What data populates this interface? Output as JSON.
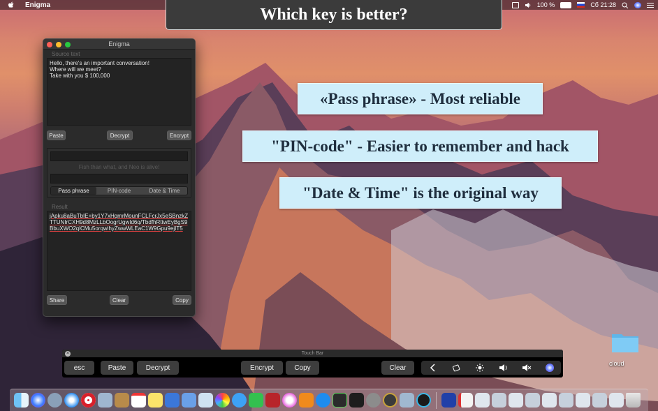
{
  "menubar": {
    "app_name": "Enigma",
    "battery": "100 %",
    "clock": "Сб 21:28"
  },
  "banner": {
    "text": "Which key is better?"
  },
  "callouts": [
    {
      "text": "«Pass phrase» - Most reliable"
    },
    {
      "text": "\"PIN-code\" - Easier to remember and hack"
    },
    {
      "text": "\"Date & Time\" is the original way"
    }
  ],
  "window": {
    "title": "Enigma",
    "source_label": "Source text",
    "source_text": "Hello, there's an important conversation!\nWhere will we meet?\nTake with you $ 100,000",
    "paste_label": "Paste",
    "decrypt_label": "Decrypt",
    "encrypt_label": "Encrypt",
    "key_hint": "Fish than what, and Neo is alive!",
    "tabs": [
      "Pass phrase",
      "PIN-code",
      "Date & Time"
    ],
    "selected_tab": "Pass phrase",
    "result_label": "Result",
    "result_text": "jApku8aBuTbIE+by1Y7xHqmrMounFCLFcrJx5eSBnzkZTTUNIrCXH9d8MzLLbOogrUgwId6q/TbdfhRttwEyBgS9BbuXWO2qlCMu5orqwihyZwwWLEaC1W9Gpu9ejIT5",
    "share_label": "Share",
    "clear_label": "Clear",
    "copy_label": "Copy"
  },
  "touchbar": {
    "title": "Touch Bar",
    "buttons": [
      "esc",
      "Paste",
      "Decrypt",
      "Encrypt",
      "Copy",
      "Clear"
    ],
    "controls": [
      "chevron-left-icon",
      "screen-lock-icon",
      "brightness-icon",
      "volume-icon",
      "mute-icon",
      "siri-icon"
    ]
  },
  "desktop": {
    "folder_label": "cloud"
  },
  "colors": {
    "callout_bg": "#cfeefa",
    "banner_bg": "#3b3b3b",
    "close": "#fd5f57",
    "minimize": "#fdbc2e",
    "zoom": "#28c840"
  }
}
